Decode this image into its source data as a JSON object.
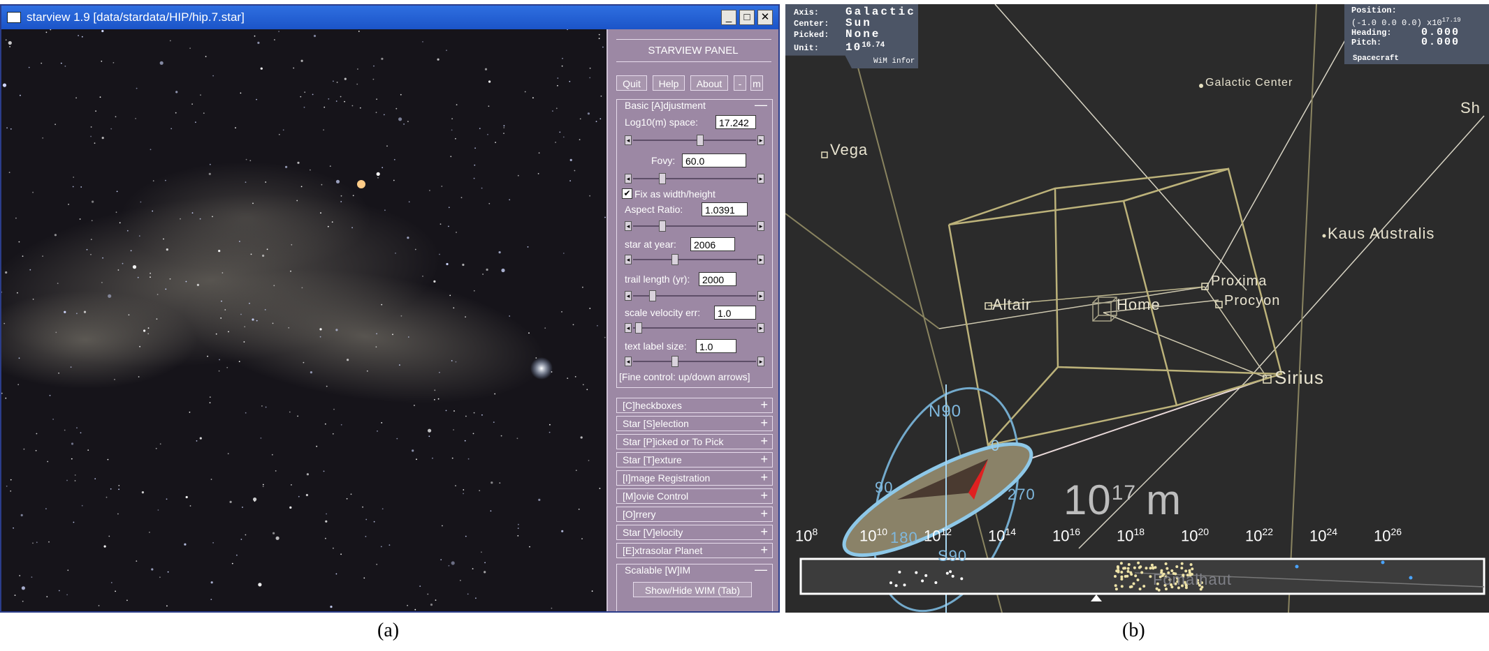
{
  "panel_a": {
    "window_title": "starview 1.9 [data/stardata/HIP/hip.7.star]",
    "window_buttons": {
      "minimize": "_",
      "maximize": "□",
      "close": "✕"
    },
    "panel_title": "STARVIEW PANEL",
    "buttons": {
      "quit": "Quit",
      "help": "Help",
      "about": "About",
      "minus": "-",
      "m": "m"
    },
    "basic_group": {
      "label": "Basic [A]djustment",
      "sign": "—",
      "log10_label": "Log10(m) space:",
      "log10_value": "17.242",
      "fovy_label": "Fovy:",
      "fovy_value": "60.0",
      "fix_label": "Fix as width/height",
      "fix_checked": true,
      "aspect_label": "Aspect Ratio:",
      "aspect_value": "1.0391",
      "year_label": "star at year:",
      "year_value": "2006",
      "trail_label": "trail length (yr):",
      "trail_value": "2000",
      "velocity_label": "scale velocity err:",
      "velocity_value": "1.0",
      "textsize_label": "text label size:",
      "textsize_value": "1.0",
      "fine_control": "[Fine control: up/down arrows]"
    },
    "slider_levels": [
      0.55,
      0.22,
      0.22,
      0.33,
      0.14,
      0.02,
      0.33
    ],
    "collapsed_groups": [
      {
        "label": "[C]heckboxes",
        "sign": "+"
      },
      {
        "label": "Star [S]election",
        "sign": "+"
      },
      {
        "label": "Star [P]icked or To Pick",
        "sign": "+"
      },
      {
        "label": "Star [T]exture",
        "sign": "+"
      },
      {
        "label": "[I]mage Registration",
        "sign": "+"
      },
      {
        "label": "[M]ovie Control",
        "sign": "+"
      },
      {
        "label": "[O]rrery",
        "sign": "+"
      },
      {
        "label": "Star [V]elocity",
        "sign": "+"
      },
      {
        "label": "[E]xtrasolar Planet",
        "sign": "+"
      }
    ],
    "wim_group": {
      "label": "Scalable [W]IM",
      "sign": "—",
      "button": "Show/Hide WIM (Tab)"
    }
  },
  "panel_b": {
    "hud_left": {
      "axis_label": "Axis:",
      "axis_value": "Galactic",
      "center_label": "Center:",
      "center_value": "Sun",
      "picked_label": "Picked:",
      "picked_value": "None",
      "unit_label": "Unit:",
      "unit_base": "10",
      "unit_exp": "16.74",
      "footer": "WiM infor"
    },
    "hud_right": {
      "position_label": "Position:",
      "position_value": "(-1.0  0.0  0.0)",
      "position_scale": "x10",
      "position_exp": "17.19",
      "heading_label": "Heading:",
      "heading_value": "0.000",
      "pitch_label": "Pitch:",
      "pitch_value": "0.000",
      "footer": "Spacecraft"
    },
    "star_labels": {
      "galactic_center": "Galactic Center",
      "sh": "Sh",
      "vega": "Vega",
      "kaus": "Kaus Australis",
      "proxima": "Proxima",
      "altair": "Altair",
      "home": "Home",
      "procyon": "Procyon",
      "sirius": "Sirius",
      "fomalhaut": "Fomalhaut"
    },
    "compass": {
      "n90": "N90",
      "zero": "0",
      "ninety": "90",
      "oneeighty": "180",
      "two70": "270",
      "s90": "S90"
    },
    "scale_label_base": "10",
    "scale_label_exp": "17",
    "scale_label_unit": "m",
    "scale_ticks": [
      {
        "base": "10",
        "exp": "8"
      },
      {
        "base": "10",
        "exp": "10"
      },
      {
        "base": "10",
        "exp": "12"
      },
      {
        "base": "10",
        "exp": "14"
      },
      {
        "base": "10",
        "exp": "16"
      },
      {
        "base": "10",
        "exp": "18"
      },
      {
        "base": "10",
        "exp": "20"
      },
      {
        "base": "10",
        "exp": "22"
      },
      {
        "base": "10",
        "exp": "24"
      },
      {
        "base": "10",
        "exp": "26"
      }
    ]
  },
  "captions": {
    "a": "(a)",
    "b": "(b)"
  }
}
